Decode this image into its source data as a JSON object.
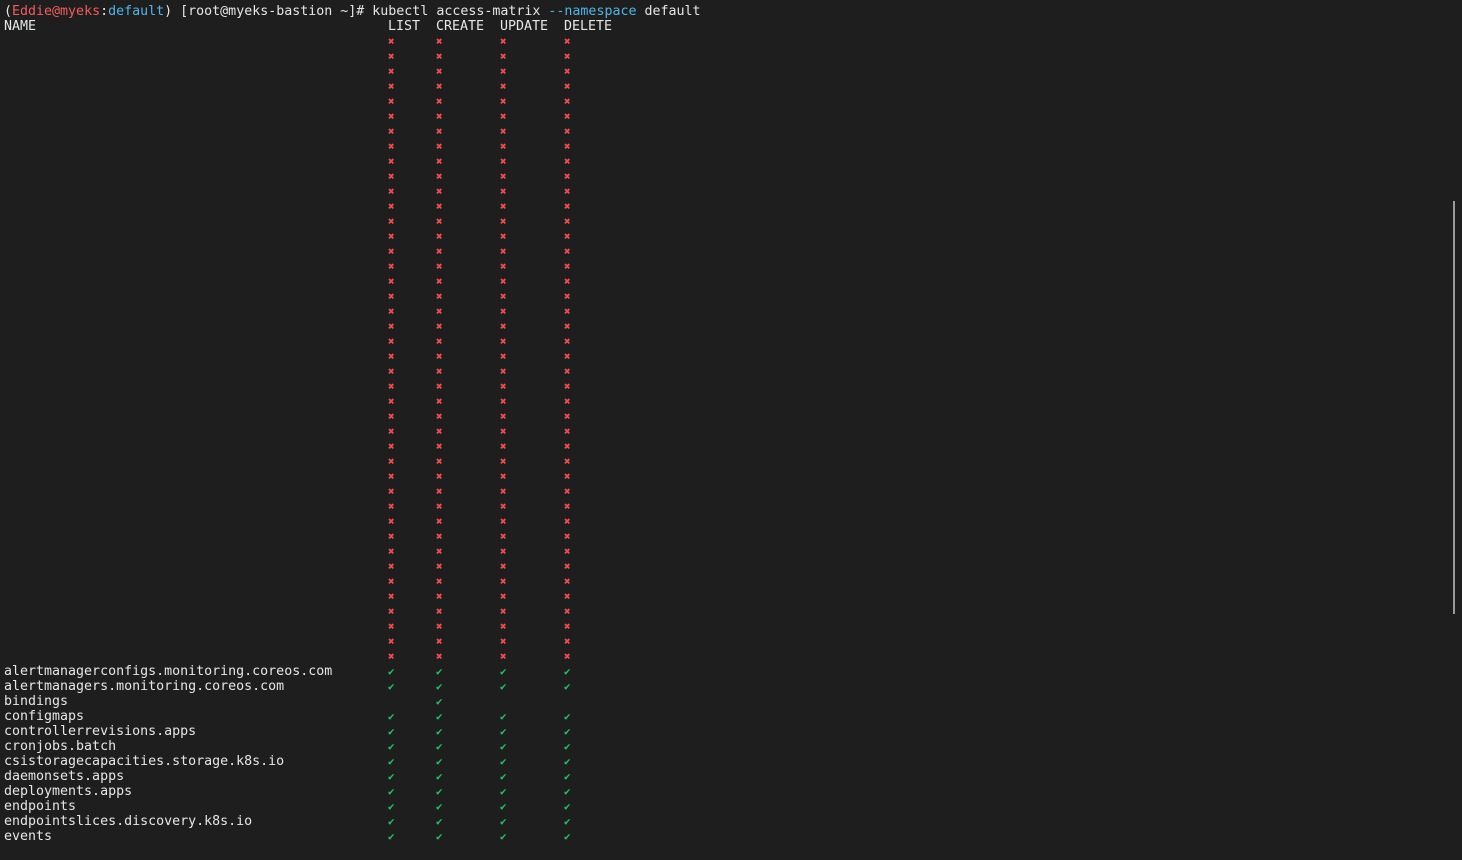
{
  "terminal": {
    "prompt": {
      "open_paren": "(",
      "user_host": "Eddie@myeks",
      "colon": ":",
      "namespace": "default",
      "close_rest": ") [root@myeks-bastion ~]# ",
      "command": "kubectl access-matrix ",
      "flag": "--namespace",
      "flag_value": " default"
    },
    "header": {
      "name": "NAME",
      "list": "LIST",
      "create": "CREATE",
      "update": "UPDATE",
      "delete": "DELETE"
    },
    "symbols": {
      "deny": "✖",
      "allow": "✔"
    },
    "unnamed_denied_row_count": 42,
    "colors": {
      "background": "#1e1e1e",
      "text": "#e6e6e6",
      "deny": "#f24c4c",
      "allow": "#23c06b",
      "prompt_user": "#f25c5c",
      "prompt_namespace": "#4fb6e6"
    },
    "rows": [
      {
        "name": "alertmanagerconfigs.monitoring.coreos.com",
        "list": "✔",
        "create": "✔",
        "update": "✔",
        "delete": "✔"
      },
      {
        "name": "alertmanagers.monitoring.coreos.com",
        "list": "✔",
        "create": "✔",
        "update": "✔",
        "delete": "✔"
      },
      {
        "name": "bindings",
        "list": "",
        "create": "✔",
        "update": "",
        "delete": ""
      },
      {
        "name": "configmaps",
        "list": "✔",
        "create": "✔",
        "update": "✔",
        "delete": "✔"
      },
      {
        "name": "controllerrevisions.apps",
        "list": "✔",
        "create": "✔",
        "update": "✔",
        "delete": "✔"
      },
      {
        "name": "cronjobs.batch",
        "list": "✔",
        "create": "✔",
        "update": "✔",
        "delete": "✔"
      },
      {
        "name": "csistoragecapacities.storage.k8s.io",
        "list": "✔",
        "create": "✔",
        "update": "✔",
        "delete": "✔"
      },
      {
        "name": "daemonsets.apps",
        "list": "✔",
        "create": "✔",
        "update": "✔",
        "delete": "✔"
      },
      {
        "name": "deployments.apps",
        "list": "✔",
        "create": "✔",
        "update": "✔",
        "delete": "✔"
      },
      {
        "name": "endpoints",
        "list": "✔",
        "create": "✔",
        "update": "✔",
        "delete": "✔"
      },
      {
        "name": "endpointslices.discovery.k8s.io",
        "list": "✔",
        "create": "✔",
        "update": "✔",
        "delete": "✔"
      },
      {
        "name": "events",
        "list": "✔",
        "create": "✔",
        "update": "✔",
        "delete": "✔"
      }
    ]
  }
}
